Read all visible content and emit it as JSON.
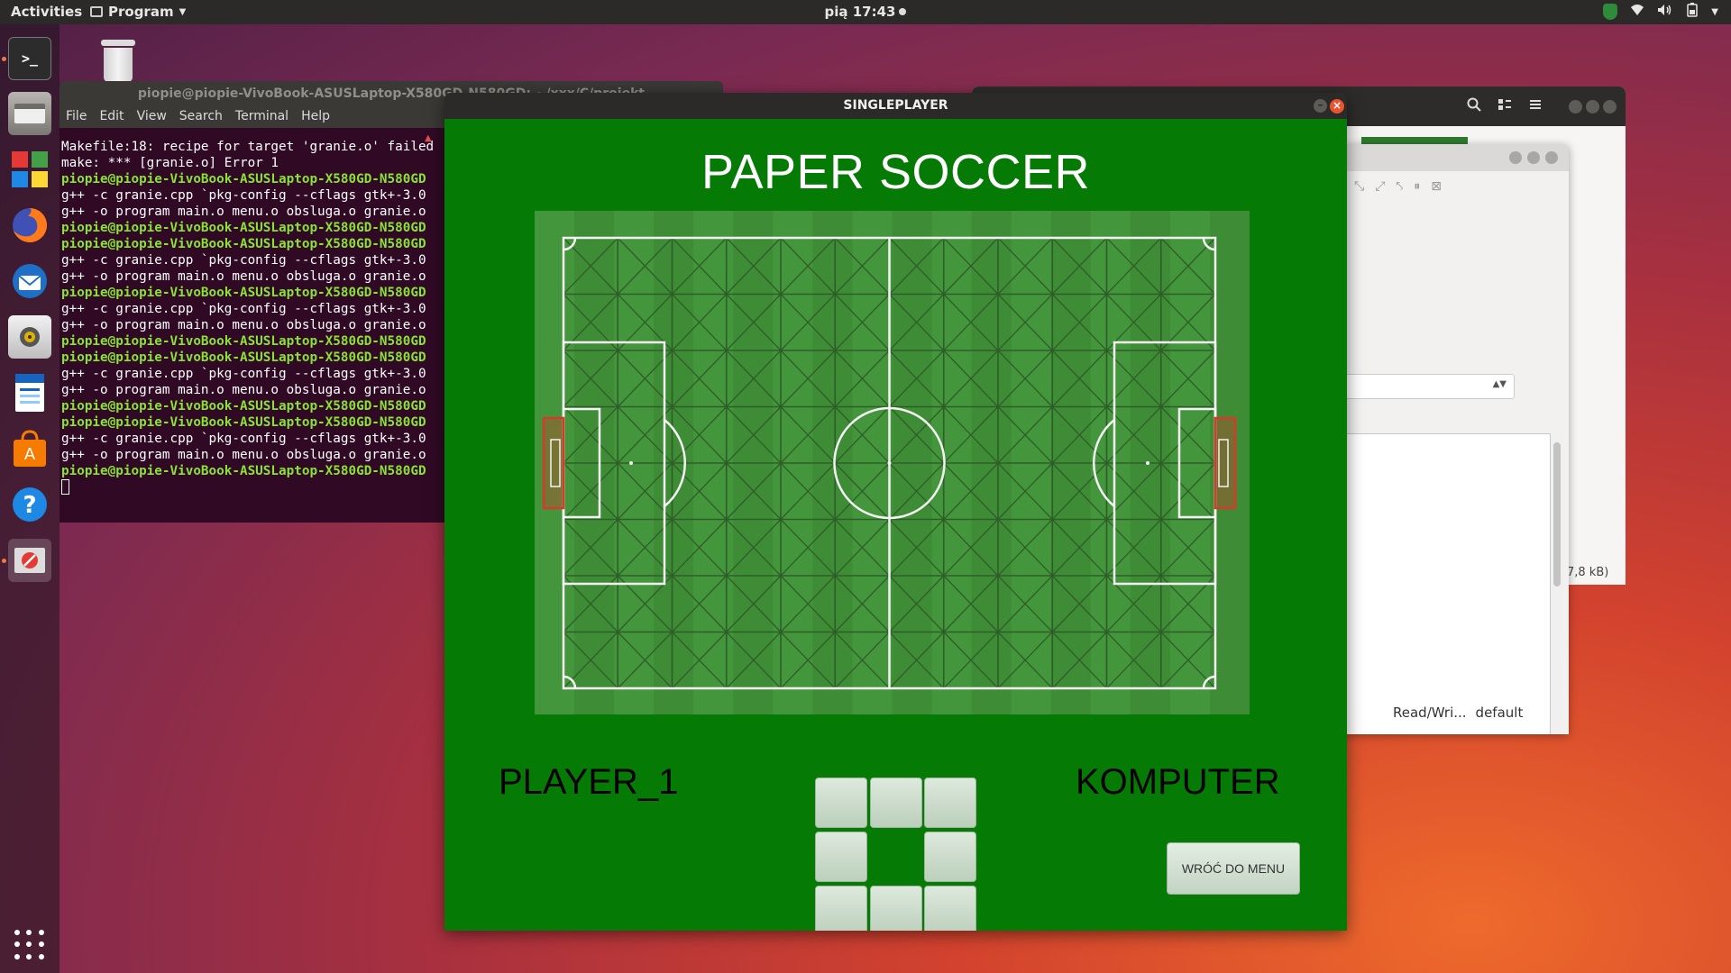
{
  "topbar": {
    "activities": "Activities",
    "app_name": "Program",
    "clock": "pią 17:43"
  },
  "dock": {
    "items": [
      {
        "name": "terminal",
        "icon": "terminal-icon"
      },
      {
        "name": "files",
        "icon": "files-icon"
      },
      {
        "name": "windows",
        "icon": "colorful-windows-icon"
      },
      {
        "name": "firefox",
        "icon": "firefox-icon"
      },
      {
        "name": "thunderbird",
        "icon": "thunderbird-icon"
      },
      {
        "name": "rhythmbox",
        "icon": "speaker-icon"
      },
      {
        "name": "writer",
        "icon": "document-icon"
      },
      {
        "name": "software",
        "icon": "shopping-bag-icon"
      },
      {
        "name": "help",
        "icon": "help-icon"
      },
      {
        "name": "program",
        "icon": "stop-icon"
      }
    ]
  },
  "terminal": {
    "title": "piopie@piopie-VivoBook-ASUSLaptop-X580GD-N580GD: ~/xxx/C/projekt",
    "menu": [
      "File",
      "Edit",
      "View",
      "Search",
      "Terminal",
      "Help"
    ],
    "lines": [
      {
        "text": "Makefile:18: recipe for target 'granie.o' failed",
        "prompt": false
      },
      {
        "text": "make: *** [granie.o] Error 1",
        "prompt": false
      },
      {
        "text": "piopie@piopie-VivoBook-ASUSLaptop-X580GD-N580GD",
        "prompt": true
      },
      {
        "text": "g++ -c granie.cpp `pkg-config --cflags gtk+-3.0",
        "prompt": false
      },
      {
        "text": "g++ -o program main.o menu.o obsluga.o granie.o",
        "prompt": false
      },
      {
        "text": "piopie@piopie-VivoBook-ASUSLaptop-X580GD-N580GD",
        "prompt": true
      },
      {
        "text": "piopie@piopie-VivoBook-ASUSLaptop-X580GD-N580GD",
        "prompt": true
      },
      {
        "text": "g++ -c granie.cpp `pkg-config --cflags gtk+-3.0",
        "prompt": false
      },
      {
        "text": "g++ -o program main.o menu.o obsluga.o granie.o",
        "prompt": false
      },
      {
        "text": "piopie@piopie-VivoBook-ASUSLaptop-X580GD-N580GD",
        "prompt": true
      },
      {
        "text": "g++ -c granie.cpp `pkg-config --cflags gtk+-3.0",
        "prompt": false
      },
      {
        "text": "g++ -o program main.o menu.o obsluga.o granie.o",
        "prompt": false
      },
      {
        "text": "piopie@piopie-VivoBook-ASUSLaptop-X580GD-N580GD",
        "prompt": true
      },
      {
        "text": "piopie@piopie-VivoBook-ASUSLaptop-X580GD-N580GD",
        "prompt": true
      },
      {
        "text": "g++ -c granie.cpp `pkg-config --cflags gtk+-3.0",
        "prompt": false
      },
      {
        "text": "g++ -o program main.o menu.o obsluga.o granie.o",
        "prompt": false
      },
      {
        "text": "piopie@piopie-VivoBook-ASUSLaptop-X580GD-N580GD",
        "prompt": true
      },
      {
        "text": "piopie@piopie-VivoBook-ASUSLaptop-X580GD-N580GD",
        "prompt": true
      },
      {
        "text": "g++ -c granie.cpp `pkg-config --cflags gtk+-3.0",
        "prompt": false
      },
      {
        "text": "g++ -o program main.o menu.o obsluga.o granie.o",
        "prompt": false
      },
      {
        "text": "piopie@piopie-VivoBook-ASUSLaptop-X580GD-N580GD",
        "prompt": true
      }
    ]
  },
  "file_window": {
    "status_size": "7,8 kB)"
  },
  "dialog": {
    "status_mode": "Read/Wri...",
    "status_profile": "default"
  },
  "game": {
    "window_title": "SINGLEPLAYER",
    "heading": "PAPER SOCCER",
    "player1": "PLAYER_1",
    "player2": "KOMPUTER",
    "menu_button": "WRÓĆ DO MENU",
    "colors": {
      "background": "#057a05",
      "goal": "#d63a2a",
      "lines": "#ffffff"
    },
    "direction_buttons": [
      "up-left",
      "up",
      "up-right",
      "left",
      "right",
      "down-left",
      "down",
      "down-right"
    ]
  }
}
